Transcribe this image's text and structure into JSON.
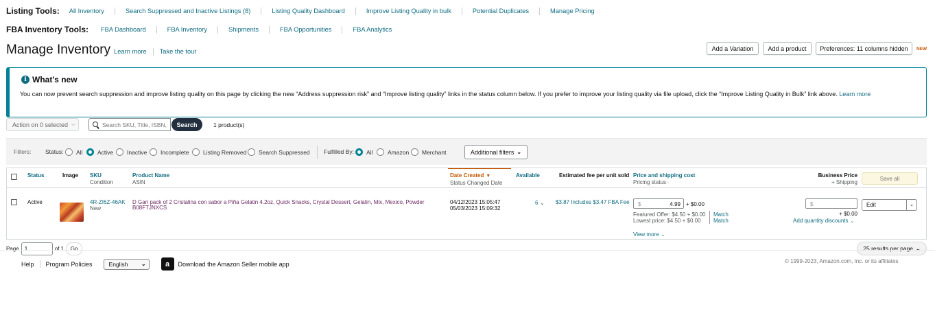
{
  "listing_tools": {
    "title": "Listing Tools:",
    "links": [
      "All Inventory",
      "Search Suppressed and Inactive Listings (8)",
      "Listing Quality Dashboard",
      "Improve Listing Quality in bulk",
      "Potential Duplicates",
      "Manage Pricing"
    ]
  },
  "fba_tools": {
    "title": "FBA Inventory Tools:",
    "links": [
      "FBA Dashboard",
      "FBA Inventory",
      "Shipments",
      "FBA Opportunities",
      "FBA Analytics"
    ]
  },
  "header": {
    "title": "Manage Inventory",
    "learn_more": "Learn more",
    "take_tour": "Take the tour",
    "add_variation": "Add a Variation",
    "add_product": "Add a product",
    "preferences": "Preferences: 11 columns hidden",
    "new_badge": "NEW"
  },
  "whats_new": {
    "title": "What's new",
    "text": "You can now prevent search suppression and improve listing quality on this page by clicking the new “Address suppression risk” and “Improve listing quality” links in the status column below. If you prefer to improve your listing quality via file upload, click the “Improve Listing Quality in Bulk” link above.",
    "learn_more": "Learn more"
  },
  "search": {
    "action_label": "Action on 0 selected",
    "placeholder": "Search SKU, Title, ISBN,",
    "button": "Search",
    "count": "1 product(s)"
  },
  "filters": {
    "label": "Filters:",
    "status_label": "Status:",
    "status_options": [
      "All",
      "Active",
      "Inactive",
      "Incomplete",
      "Listing Removed",
      "Search Suppressed"
    ],
    "status_selected": "Active",
    "fulfilled_label": "Fulfilled By:",
    "fulfilled_options": [
      "All",
      "Amazon",
      "Merchant"
    ],
    "fulfilled_selected": "All",
    "additional": "Additional filters"
  },
  "table": {
    "headers": {
      "status": "Status",
      "image": "Image",
      "sku": "SKU",
      "condition": "Condition",
      "product_name": "Product Name",
      "asin": "ASIN",
      "date_created": "Date Created",
      "status_changed": "Status Changed Date",
      "available": "Available",
      "est_fee": "Estimated fee per unit sold",
      "price_shipping": "Price and shipping cost",
      "pricing_status": "Pricing status",
      "business_price": "Business Price",
      "plus_shipping": "+ Shipping",
      "save_all": "Save all"
    },
    "rows": [
      {
        "status": "Active",
        "sku": "4R-ZI6Z-46AK",
        "condition": "New",
        "product_name": "D Gari pack of 2 Cristalina con sabor a Piña Gelatin 4.2oz, Quick Snacks, Crystal Dessert, Gelatin, Mix, Mexico, Powder",
        "asin": "B08FTJNXCS",
        "date_created": "04/12/2023 15:05:47",
        "status_changed": "05/03/2023 15:09:32",
        "available": "6",
        "est_fee": "$3.87 Includes $3.47 FBA Fee",
        "currency": "$",
        "price": "4.99",
        "shipping": "+ $0.00",
        "featured_offer": "Featured Offer: $4.50 + $0.00",
        "lowest_price": "Lowest price: $4.50 + $0.00",
        "match": "Match",
        "view_more": "View more",
        "business_currency": "$",
        "business_shipping": "+ $0.00",
        "qty_discounts": "Add quantity discounts",
        "edit": "Edit"
      }
    ]
  },
  "pager": {
    "page_label": "Page",
    "page_value": "1",
    "of": "of 1",
    "go": "Go",
    "per_page": "25 results per page"
  },
  "footer": {
    "help": "Help",
    "policies": "Program Policies",
    "language": "English",
    "app_link": "Download the Amazon Seller mobile app",
    "copyright": "© 1999-2023, Amazon.com, Inc. or its affiliates"
  },
  "colors": {
    "teal": "#008296",
    "link": "#0f6c81",
    "orange": "#c45500",
    "dark_button": "#232f3e"
  },
  "icons": [
    "info-icon",
    "search-icon",
    "chevron-down-icon",
    "sort-desc-icon",
    "amazon-app-icon"
  ]
}
